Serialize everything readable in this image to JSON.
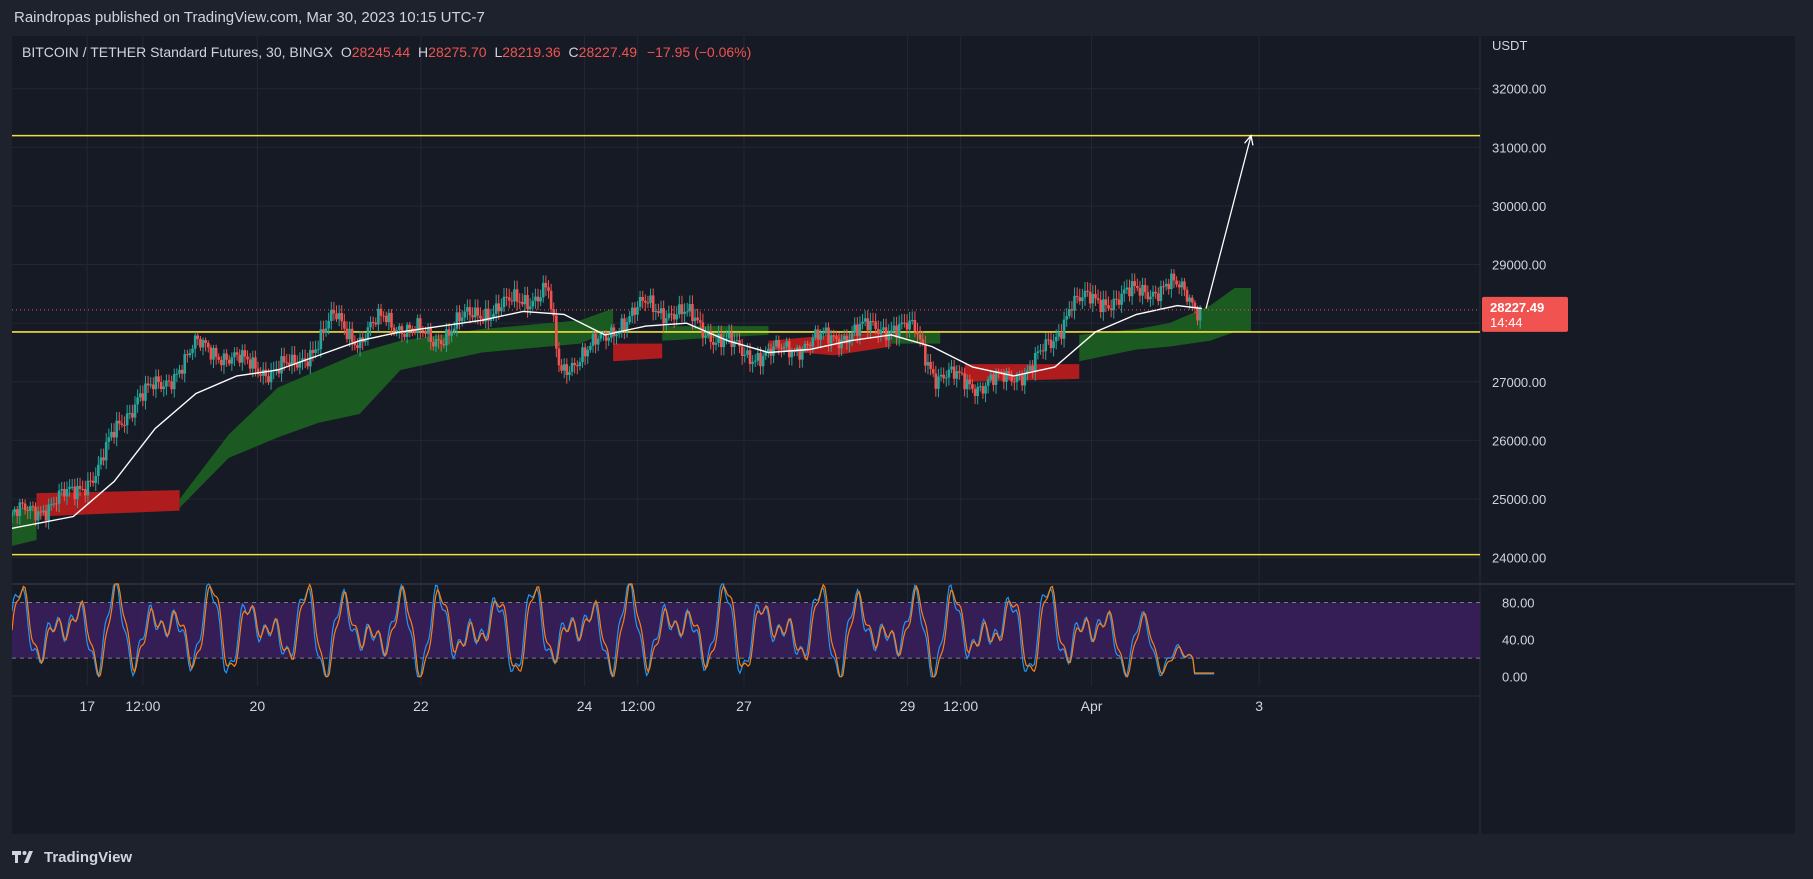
{
  "header": {
    "publisher_line": "Raindropas published on TradingView.com, Mar 30, 2023 10:15 UTC-7"
  },
  "legend": {
    "symbol": "BITCOIN / TETHER Standard Futures, 30, BINGX",
    "o_label": "O",
    "o_value": "28245.44",
    "h_label": "H",
    "h_value": "28275.70",
    "l_label": "L",
    "l_value": "28219.36",
    "c_label": "C",
    "c_value": "28227.49",
    "change": "−17.95 (−0.06%)"
  },
  "footer": {
    "brand": "TradingView"
  },
  "colors": {
    "up": "#26a69a",
    "down": "#ef5350",
    "cloud_bull": "#1b5e20",
    "cloud_bear": "#b71c1c",
    "ma": "#ffffff",
    "level": "#f2e03a",
    "stoch_bg": "#3b1f5e",
    "k": "#2196f3",
    "d": "#ff7f0e",
    "price_tag": "#f05350"
  },
  "chart_data": {
    "type": "line",
    "ylabel": "USDT",
    "yticks": [
      "32000.00",
      "31000.00",
      "30000.00",
      "29000.00",
      "27000.00",
      "26000.00",
      "25000.00",
      "24000.00"
    ],
    "xticks": [
      "17",
      "12:00",
      "20",
      "22",
      "24",
      "12:00",
      "27",
      "29",
      "12:00",
      "Apr",
      "3"
    ],
    "x_tick_pos": [
      0.17,
      0.85,
      2.25,
      4.25,
      6.25,
      6.9,
      8.2,
      10.2,
      10.85,
      12.45,
      14.5
    ],
    "ylim": [
      23600,
      32900
    ],
    "xlim": [
      -0.75,
      17.2
    ],
    "last_price": "28227.49",
    "countdown": "14:44",
    "horizontal_levels": [
      31200,
      27850,
      24050
    ],
    "price_path": [
      [
        -0.75,
        24700
      ],
      [
        -0.3,
        24900
      ],
      [
        0,
        25100
      ],
      [
        0.3,
        25500
      ],
      [
        0.5,
        26100
      ],
      [
        0.8,
        26800
      ],
      [
        1.1,
        26900
      ],
      [
        1.3,
        27300
      ],
      [
        1.5,
        27600
      ],
      [
        1.8,
        27500
      ],
      [
        2.1,
        27300
      ],
      [
        2.4,
        27200
      ],
      [
        2.7,
        27250
      ],
      [
        3.0,
        27700
      ],
      [
        3.2,
        28100
      ],
      [
        3.5,
        27700
      ],
      [
        3.8,
        28100
      ],
      [
        4.1,
        27900
      ],
      [
        4.4,
        27700
      ],
      [
        4.7,
        28000
      ],
      [
        5.0,
        28200
      ],
      [
        5.3,
        28300
      ],
      [
        5.6,
        28450
      ],
      [
        5.8,
        28600
      ],
      [
        5.95,
        27100
      ],
      [
        6.2,
        27500
      ],
      [
        6.5,
        27700
      ],
      [
        6.7,
        28050
      ],
      [
        7.0,
        28300
      ],
      [
        7.3,
        28200
      ],
      [
        7.6,
        28050
      ],
      [
        7.9,
        27700
      ],
      [
        8.2,
        27500
      ],
      [
        8.5,
        27450
      ],
      [
        8.8,
        27600
      ],
      [
        9.1,
        27700
      ],
      [
        9.4,
        27800
      ],
      [
        9.7,
        27900
      ],
      [
        10.0,
        27950
      ],
      [
        10.3,
        27850
      ],
      [
        10.55,
        27100
      ],
      [
        10.8,
        27050
      ],
      [
        11.1,
        26950
      ],
      [
        11.4,
        27050
      ],
      [
        11.7,
        27250
      ],
      [
        12.0,
        27700
      ],
      [
        12.2,
        28400
      ],
      [
        12.5,
        28350
      ],
      [
        12.8,
        28450
      ],
      [
        13.1,
        28550
      ],
      [
        13.4,
        28650
      ],
      [
        13.6,
        28500
      ],
      [
        13.8,
        28227
      ]
    ],
    "ma_path": [
      [
        -0.75,
        24500
      ],
      [
        0,
        24700
      ],
      [
        0.5,
        25300
      ],
      [
        1.0,
        26200
      ],
      [
        1.5,
        26800
      ],
      [
        2.0,
        27100
      ],
      [
        2.5,
        27200
      ],
      [
        3.0,
        27450
      ],
      [
        3.5,
        27700
      ],
      [
        4.0,
        27850
      ],
      [
        4.5,
        27950
      ],
      [
        5.0,
        28050
      ],
      [
        5.5,
        28200
      ],
      [
        6.0,
        28150
      ],
      [
        6.5,
        27800
      ],
      [
        7.0,
        27950
      ],
      [
        7.5,
        28000
      ],
      [
        8.0,
        27700
      ],
      [
        8.5,
        27500
      ],
      [
        9.0,
        27550
      ],
      [
        9.5,
        27700
      ],
      [
        10.0,
        27800
      ],
      [
        10.5,
        27600
      ],
      [
        11.0,
        27250
      ],
      [
        11.5,
        27100
      ],
      [
        12.0,
        27250
      ],
      [
        12.5,
        27850
      ],
      [
        13.0,
        28150
      ],
      [
        13.5,
        28300
      ],
      [
        13.8,
        28250
      ]
    ],
    "cloud_segments": [
      {
        "kind": "bear",
        "top": [
          [
            -0.45,
            25100
          ],
          [
            1.3,
            25150
          ]
        ],
        "bottom": [
          [
            -0.45,
            24700
          ],
          [
            1.3,
            24800
          ]
        ]
      },
      {
        "kind": "bull",
        "top": [
          [
            -0.75,
            24800
          ],
          [
            -0.45,
            24900
          ]
        ],
        "bottom": [
          [
            -0.75,
            24200
          ],
          [
            -0.45,
            24300
          ]
        ]
      },
      {
        "kind": "bull",
        "top": [
          [
            1.3,
            25000
          ],
          [
            1.9,
            26100
          ],
          [
            2.5,
            26900
          ],
          [
            3.0,
            27200
          ],
          [
            3.5,
            27500
          ],
          [
            4.0,
            27700
          ],
          [
            5.0,
            27900
          ],
          [
            6.2,
            28050
          ],
          [
            6.6,
            28250
          ]
        ],
        "bottom": [
          [
            1.3,
            24850
          ],
          [
            1.9,
            25700
          ],
          [
            2.5,
            26050
          ],
          [
            3.0,
            26300
          ],
          [
            3.5,
            26450
          ],
          [
            4.0,
            27200
          ],
          [
            5.0,
            27500
          ],
          [
            6.2,
            27650
          ],
          [
            6.6,
            27900
          ]
        ]
      },
      {
        "kind": "bear",
        "top": [
          [
            6.6,
            27650
          ],
          [
            7.2,
            27650
          ]
        ],
        "bottom": [
          [
            6.6,
            27350
          ],
          [
            7.2,
            27400
          ]
        ]
      },
      {
        "kind": "bull",
        "top": [
          [
            7.2,
            27950
          ],
          [
            8.5,
            27950
          ]
        ],
        "bottom": [
          [
            7.2,
            27700
          ],
          [
            8.5,
            27800
          ]
        ]
      },
      {
        "kind": "bear",
        "top": [
          [
            8.5,
            27700
          ],
          [
            9.3,
            27800
          ],
          [
            10.0,
            27850
          ]
        ],
        "bottom": [
          [
            8.5,
            27550
          ],
          [
            9.3,
            27450
          ],
          [
            10.0,
            27600
          ]
        ]
      },
      {
        "kind": "bull",
        "top": [
          [
            10.0,
            27850
          ],
          [
            10.6,
            27850
          ]
        ],
        "bottom": [
          [
            10.0,
            27650
          ],
          [
            10.6,
            27650
          ]
        ]
      },
      {
        "kind": "bear",
        "top": [
          [
            10.9,
            27300
          ],
          [
            12.3,
            27300
          ]
        ],
        "bottom": [
          [
            10.9,
            27000
          ],
          [
            12.3,
            27050
          ]
        ]
      },
      {
        "kind": "bull",
        "top": [
          [
            12.3,
            27800
          ],
          [
            13.0,
            27900
          ],
          [
            13.4,
            28000
          ],
          [
            13.9,
            28300
          ],
          [
            14.2,
            28600
          ],
          [
            14.4,
            28600
          ]
        ],
        "bottom": [
          [
            12.3,
            27350
          ],
          [
            13.0,
            27550
          ],
          [
            13.4,
            27600
          ],
          [
            13.9,
            27700
          ],
          [
            14.2,
            27850
          ],
          [
            14.4,
            27850
          ]
        ]
      }
    ],
    "projection_arrow": {
      "from": [
        13.85,
        28250
      ],
      "to": [
        14.4,
        31200
      ]
    },
    "stoch": {
      "yticks": [
        "80.00",
        "40.00",
        "0.00"
      ],
      "ylim": [
        -10,
        100
      ],
      "band": [
        20,
        80
      ]
    }
  }
}
